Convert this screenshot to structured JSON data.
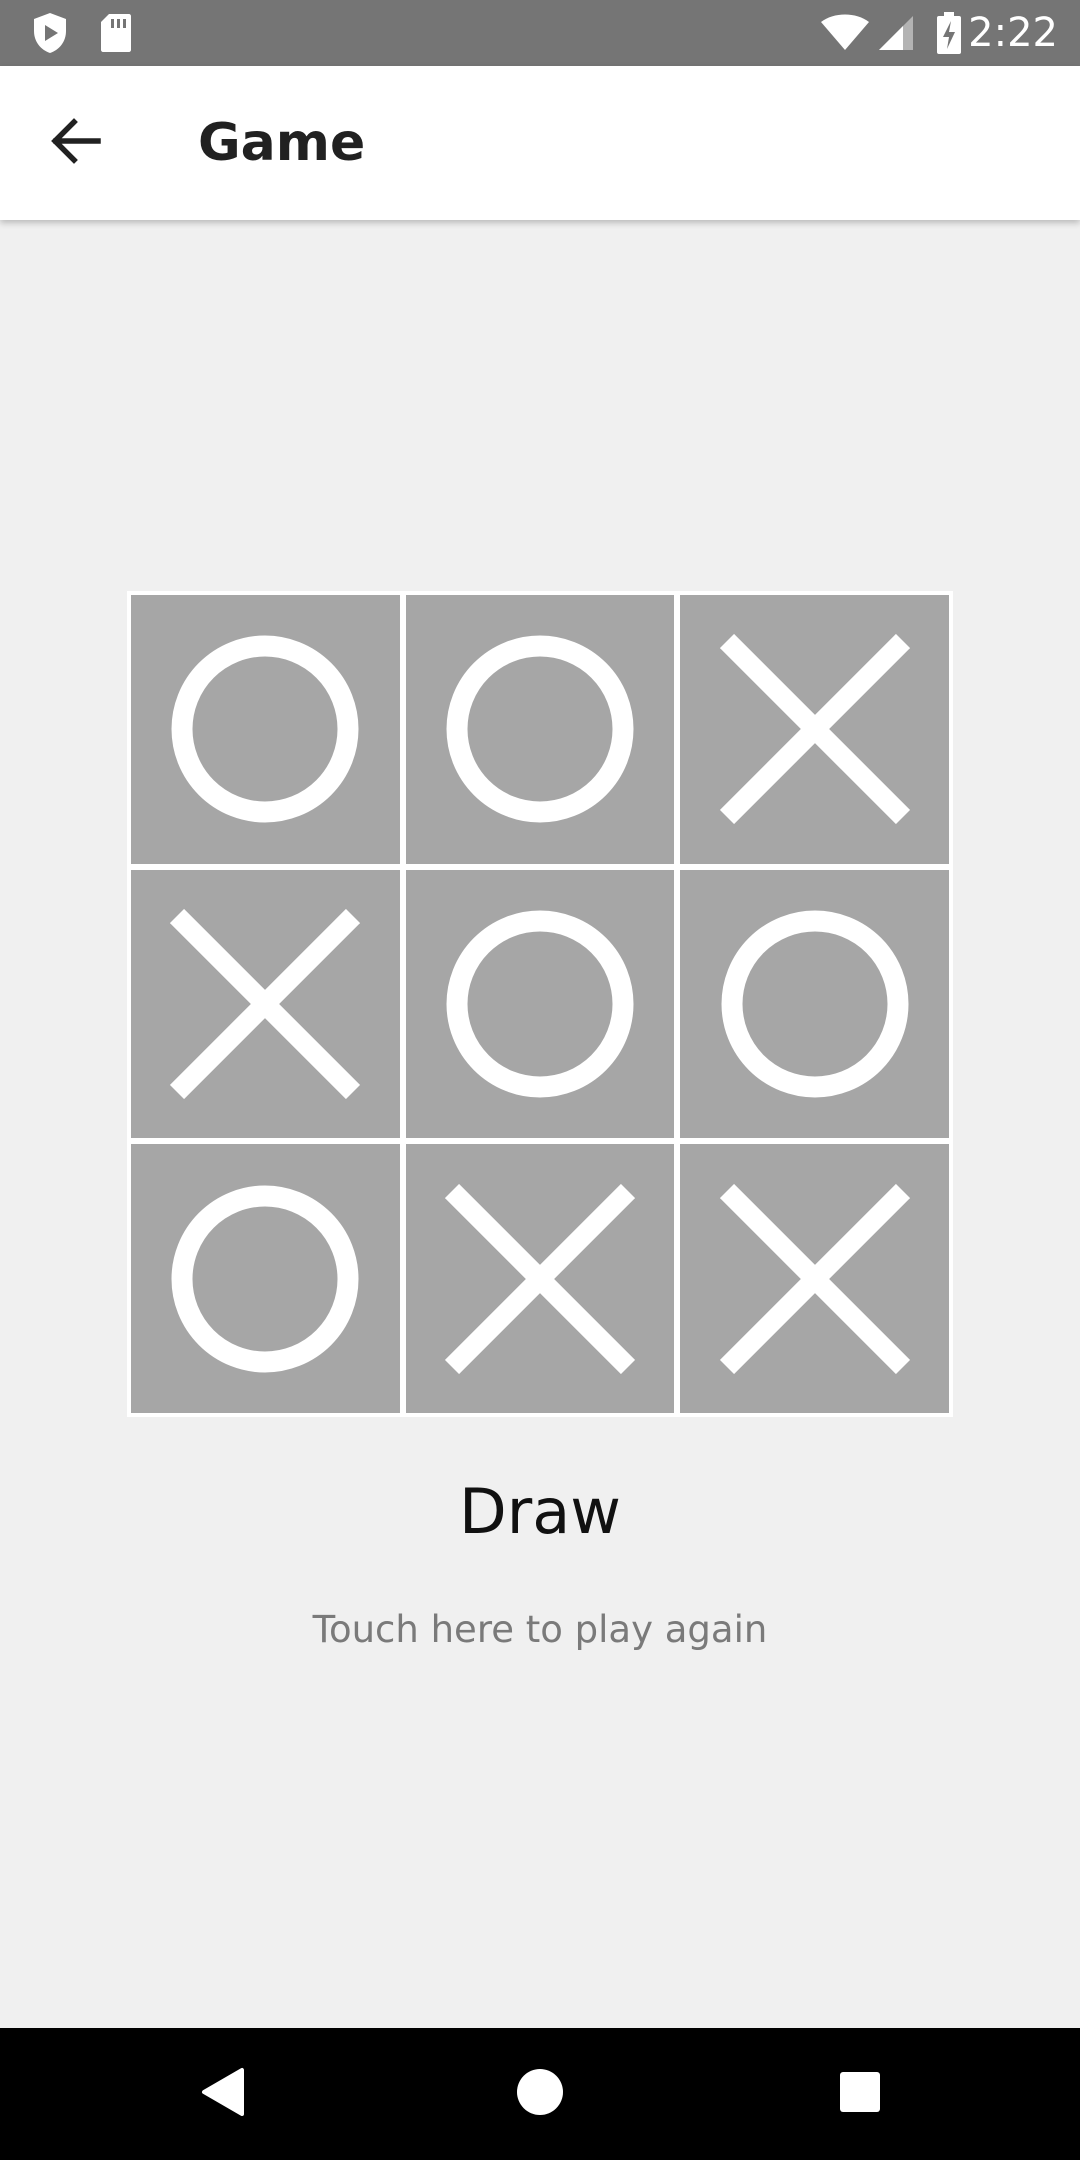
{
  "status_bar": {
    "time": "2:22",
    "icons": [
      "shield-icon",
      "sd-card-icon",
      "wifi-icon",
      "signal-icon",
      "battery-charging-icon"
    ]
  },
  "app_bar": {
    "title": "Game",
    "back_icon": "arrow-back-icon"
  },
  "board": {
    "cells": [
      "O",
      "O",
      "X",
      "X",
      "O",
      "O",
      "O",
      "X",
      "X"
    ],
    "cell_color": "#a6a6a6",
    "mark_color": "#ffffff"
  },
  "result": {
    "text": "Draw",
    "play_again": "Touch here to play again"
  },
  "nav_bar": {
    "buttons": [
      "back-triangle-icon",
      "home-circle-icon",
      "recents-square-icon"
    ]
  }
}
